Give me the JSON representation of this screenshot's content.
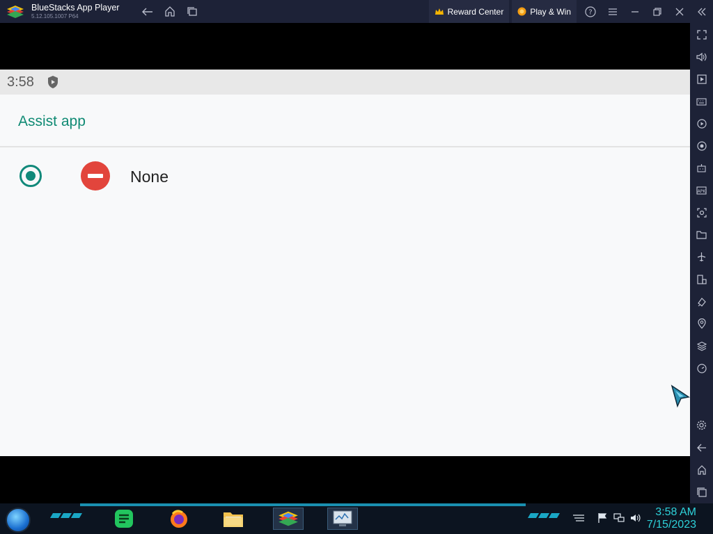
{
  "window": {
    "title": "BlueStacks App Player",
    "version": "5.12.105.1007  P64",
    "reward_center": "Reward Center",
    "play_win": "Play & Win"
  },
  "android": {
    "status_time": "3:58",
    "appbar_title": "Assist app",
    "options": [
      {
        "label": "None",
        "selected": true
      }
    ]
  },
  "taskbar": {
    "time": "3:58 AM",
    "date": "7/15/2023",
    "apps": [
      "notes-app",
      "firefox",
      "file-explorer",
      "bluestacks",
      "system-monitor"
    ]
  },
  "colors": {
    "accent": "#0f8a73",
    "none_icon": "#e2453c",
    "titlebar": "#1d2237",
    "clock_text": "#2ed1d9"
  }
}
